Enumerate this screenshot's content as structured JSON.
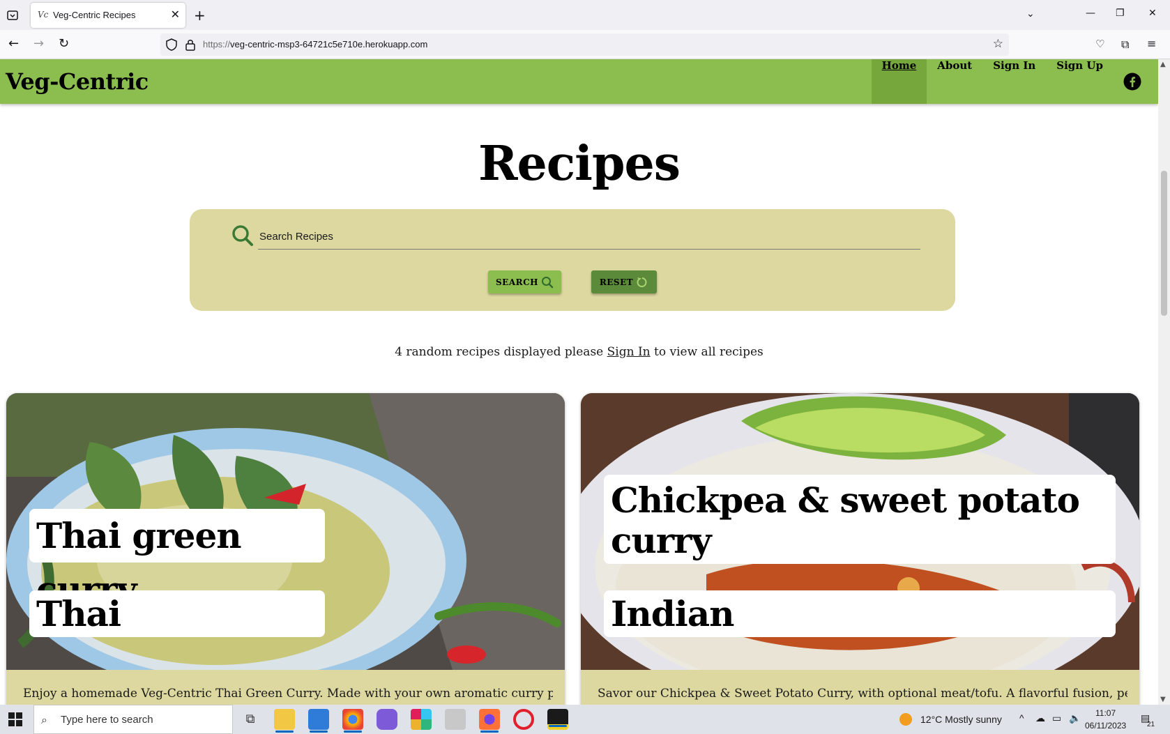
{
  "browser": {
    "tab_title": "Veg-Centric Recipes",
    "tab_favicon": "Vc",
    "url_protocol": "https://",
    "url_host": "veg-centric-msp3-64721c5e710e.herokuapp.com"
  },
  "site": {
    "brand": "Veg-Centric",
    "nav": {
      "home": "Home",
      "about": "About",
      "sign_in": "Sign In",
      "sign_up": "Sign Up",
      "social_icon": "facebook-icon"
    }
  },
  "main": {
    "title": "Recipes",
    "search": {
      "placeholder": "Search Recipes",
      "search_button": "SEARCH",
      "reset_button": "RESET"
    },
    "info": {
      "prefix": "4 random recipes displayed please",
      "link": "Sign In",
      "suffix": "to view all recipes"
    },
    "recipes": [
      {
        "name": "Thai green curry",
        "cuisine": "Thai",
        "description": "Enjoy a homemade Veg-Centric Thai Green Curry. Made with your own aromatic curry paste"
      },
      {
        "name_line1": "Chickpea & sweet potato",
        "name_line2": "curry",
        "cuisine": "Indian",
        "description": "Savor our Chickpea & Sweet Potato Curry, with optional meat/tofu. A flavorful fusion, perfect"
      }
    ]
  },
  "taskbar": {
    "search_placeholder": "Type here to search",
    "weather": "12°C  Mostly sunny",
    "time": "11:07",
    "date": "06/11/2023",
    "notifications": "21"
  },
  "colors": {
    "header_green": "#8bbd4f",
    "active_nav": "#75a73d",
    "panel_khaki": "#ddd8a0",
    "reset_green": "#5b8a3a"
  }
}
